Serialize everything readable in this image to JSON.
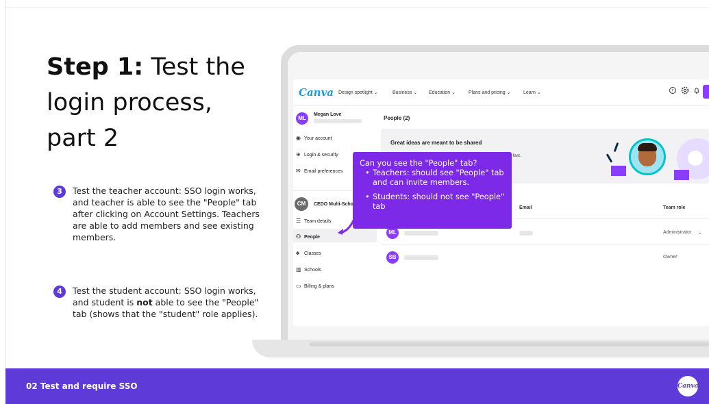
{
  "slide": {
    "title_bold": "Step 1:",
    "title_rest_line1": " Test the",
    "title_line2": "login process,",
    "title_line3": "part 2",
    "step3": {
      "num": "3",
      "text": "Test the teacher account: SSO login works, and teacher is able to see the \"People\" tab after clicking on Account Settings. Teachers are able to add members and see existing members."
    },
    "step4": {
      "num": "4",
      "text_before": "Test the student account: SSO login works, and student is ",
      "text_bold": "not",
      "text_after": " able to see the \"People\" tab (shows that the \"student\" role applies)."
    },
    "footer_text": "02 Test and require SSO",
    "footer_logo": "Canva"
  },
  "canva": {
    "logo": "Canva",
    "nav_items": [
      "Design spotlight ⌄",
      "Business ⌄",
      "Education ⌄",
      "Plans and pricing ⌄",
      "Learn ⌄"
    ],
    "nav_icons": [
      "help-icon",
      "settings-icon",
      "bell-icon"
    ],
    "user_initials": "ML",
    "user_name": "Megan Love",
    "sidebar_account": [
      "Your account",
      "Login & security",
      "Email preferences"
    ],
    "team_initials": "CM",
    "team_name": "CEDO Multi-Scho",
    "sidebar_team": [
      "Team details",
      "People",
      "Classes",
      "Schools",
      "Billing & plans"
    ],
    "people_title": "People (2)",
    "banner_title": "Great ideas are meant to be shared",
    "banner_sub": "one, fast.",
    "col_email": "Email",
    "col_role": "Team role",
    "rows": [
      {
        "initials": "ML",
        "role": "Administrator",
        "color": "#8b3dff"
      },
      {
        "initials": "SB",
        "role": "Owner",
        "color": "#8b3dff"
      }
    ],
    "role_chevron": "⌄"
  },
  "tooltip": {
    "question": "Can you see the \"People\" tab?",
    "bullet1": "Teachers: should see \"People\" tab and can invite members.",
    "bullet2": "Students: should not see \"People\" tab"
  },
  "colors": {
    "accent": "#5e3bd8",
    "tooltip": "#7c2ae8",
    "canva_purple": "#8b3dff",
    "canva_teal": "#00c4cc"
  }
}
